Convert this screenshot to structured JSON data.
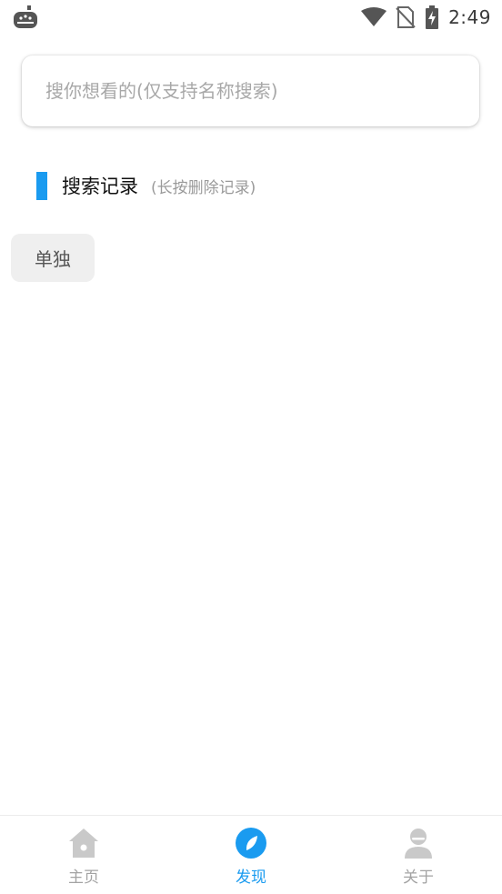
{
  "status_bar": {
    "time": "2:49",
    "icons": [
      "app-notification-icon",
      "wifi-icon",
      "no-sim-icon",
      "battery-charging-icon"
    ]
  },
  "search": {
    "placeholder": "搜你想看的(仅支持名称搜索)",
    "value": ""
  },
  "history": {
    "title": "搜索记录",
    "hint": "(长按删除记录)",
    "items": [
      "单独"
    ]
  },
  "bottom_nav": {
    "items": [
      {
        "label": "主页",
        "icon": "home-icon"
      },
      {
        "label": "发现",
        "icon": "compass-icon"
      },
      {
        "label": "关于",
        "icon": "person-icon"
      }
    ],
    "active_index": 1
  },
  "colors": {
    "accent": "#1a9bf0",
    "inactive": "#a3a3a3",
    "chip_bg": "#efefef",
    "hint_text": "#9a9a9a"
  }
}
